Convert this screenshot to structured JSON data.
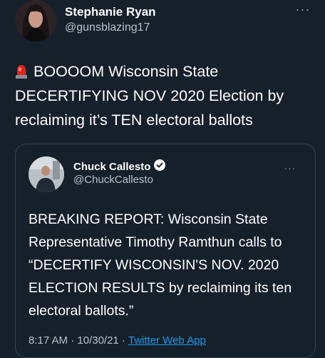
{
  "tweet": {
    "author_name": "Stephanie Ryan",
    "author_handle": "@gunsblazing17",
    "more_label": "···",
    "text": "BOOOOM  Wisconsin State DECERTIFYING NOV 2020 Election by reclaiming it’s TEN electoral ballots",
    "emoji_icon": "siren-icon"
  },
  "quoted": {
    "author_name": "Chuck Callesto",
    "author_handle": "@ChuckCallesto",
    "more_label": "···",
    "verified_icon": "verified-badge-icon",
    "text": "BREAKING REPORT: Wisconsin State Representative Timothy Ramthun calls to “DECERTIFY WISCONSIN'S NOV. 2020 ELECTION RESULTS by reclaiming its ten electoral ballots.”",
    "time": "8:17 AM",
    "date": "10/30/21",
    "separator": "·",
    "app": "Twitter Web App"
  },
  "colors": {
    "background": "#15202b",
    "link": "#1d9bf0",
    "secondary_text": "#b8c2cc"
  }
}
